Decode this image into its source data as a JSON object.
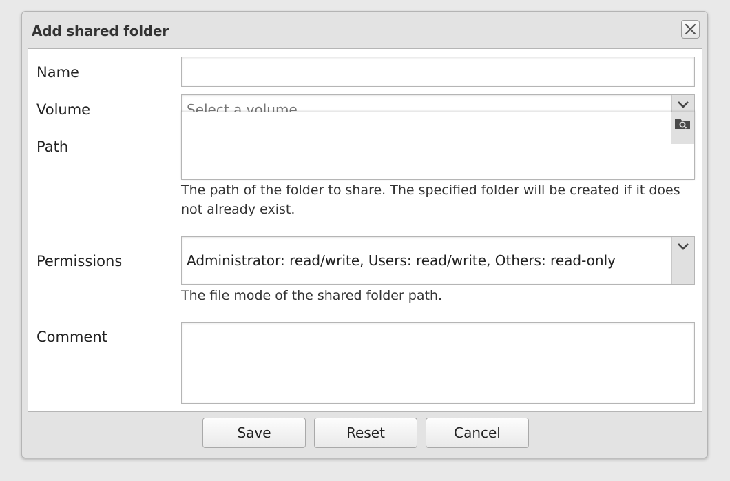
{
  "dialog": {
    "title": "Add shared folder",
    "close_icon": "close-icon"
  },
  "form": {
    "name": {
      "label": "Name",
      "value": ""
    },
    "volume": {
      "label": "Volume",
      "placeholder": "Select a volume ..."
    },
    "path": {
      "label": "Path",
      "value": "",
      "description": "The path of the folder to share. The specified folder will be created if it does not already exist."
    },
    "permissions": {
      "label": "Permissions",
      "value": "Administrator: read/write, Users: read/write, Others: read-only",
      "description": "The file mode of the shared folder path."
    },
    "comment": {
      "label": "Comment",
      "value": ""
    }
  },
  "buttons": {
    "save": "Save",
    "reset": "Reset",
    "cancel": "Cancel"
  }
}
